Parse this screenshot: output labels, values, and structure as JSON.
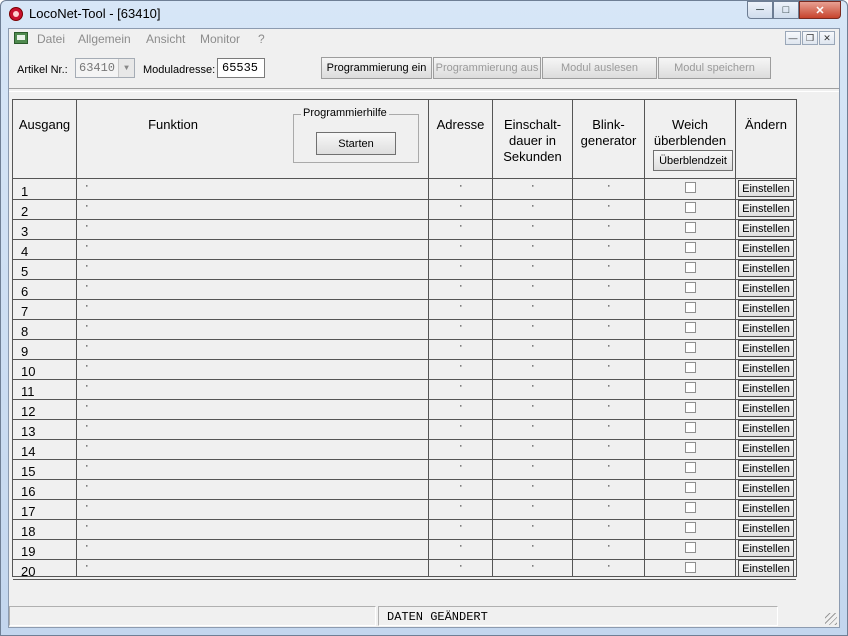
{
  "window": {
    "title": "LocoNet-Tool - [63410]"
  },
  "menu": [
    "Datei",
    "Allgemein",
    "Ansicht",
    "Monitor",
    "?"
  ],
  "toolbar": {
    "artikel_label": "Artikel Nr.:",
    "artikel_value": "63410",
    "modul_label": "Moduladresse:",
    "modul_value": "65535",
    "buttons": [
      "Programmierung ein",
      "Programmierung aus",
      "Modul auslesen",
      "Modul speichern"
    ]
  },
  "table": {
    "headers": {
      "ausgang": "Ausgang",
      "funktion": "Funktion",
      "adresse": "Adresse",
      "einschalt_1": "Einschalt-",
      "einschalt_2": "dauer in",
      "einschalt_3": "Sekunden",
      "blink_1": "Blink-",
      "blink_2": "generator",
      "weich_1": "Weich",
      "weich_2": "überblenden",
      "aendern": "Ändern"
    },
    "programmierhilfe": "Programmierhilfe",
    "starten": "Starten",
    "ueberblendzeit": "Überblendzeit",
    "placeholder": "·",
    "einstellen": "Einstellen",
    "rows": [
      "1",
      "2",
      "3",
      "4",
      "5",
      "6",
      "7",
      "8",
      "9",
      "10",
      "11",
      "12",
      "13",
      "14",
      "15",
      "16",
      "17",
      "18",
      "19",
      "20"
    ]
  },
  "status": {
    "text": "DATEN GEÄNDERT"
  }
}
